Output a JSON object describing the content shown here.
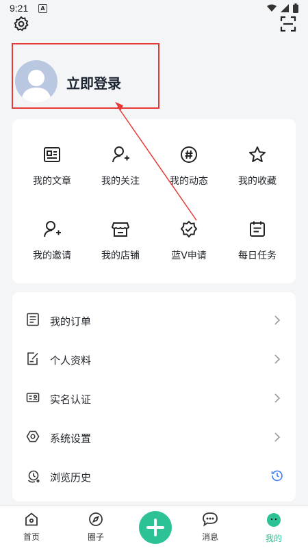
{
  "status": {
    "time": "9:21",
    "notif": "A"
  },
  "header": {
    "settings_icon": "gear-icon",
    "scan_icon": "scan-icon"
  },
  "profile": {
    "login_label": "立即登录"
  },
  "grid": {
    "items": [
      {
        "label": "我的文章",
        "icon": "article-icon"
      },
      {
        "label": "我的关注",
        "icon": "follow-user-icon"
      },
      {
        "label": "我的动态",
        "icon": "hashtag-icon"
      },
      {
        "label": "我的收藏",
        "icon": "star-icon"
      },
      {
        "label": "我的邀请",
        "icon": "invite-user-icon"
      },
      {
        "label": "我的店铺",
        "icon": "store-icon"
      },
      {
        "label": "蓝V申请",
        "icon": "verified-badge-icon"
      },
      {
        "label": "每日任务",
        "icon": "calendar-task-icon"
      }
    ]
  },
  "list": {
    "items": [
      {
        "label": "我的订单",
        "icon": "order-icon"
      },
      {
        "label": "个人资料",
        "icon": "profile-edit-icon"
      },
      {
        "label": "实名认证",
        "icon": "id-card-icon"
      },
      {
        "label": "系统设置",
        "icon": "settings-hex-icon"
      },
      {
        "label": "浏览历史",
        "icon": "history-icon"
      }
    ]
  },
  "nav": {
    "home": "首页",
    "circle": "圈子",
    "messages": "消息",
    "mine": "我的"
  },
  "colors": {
    "accent": "#2cc295",
    "highlight": "#e53935",
    "history_icon": "#3d7ef6"
  }
}
